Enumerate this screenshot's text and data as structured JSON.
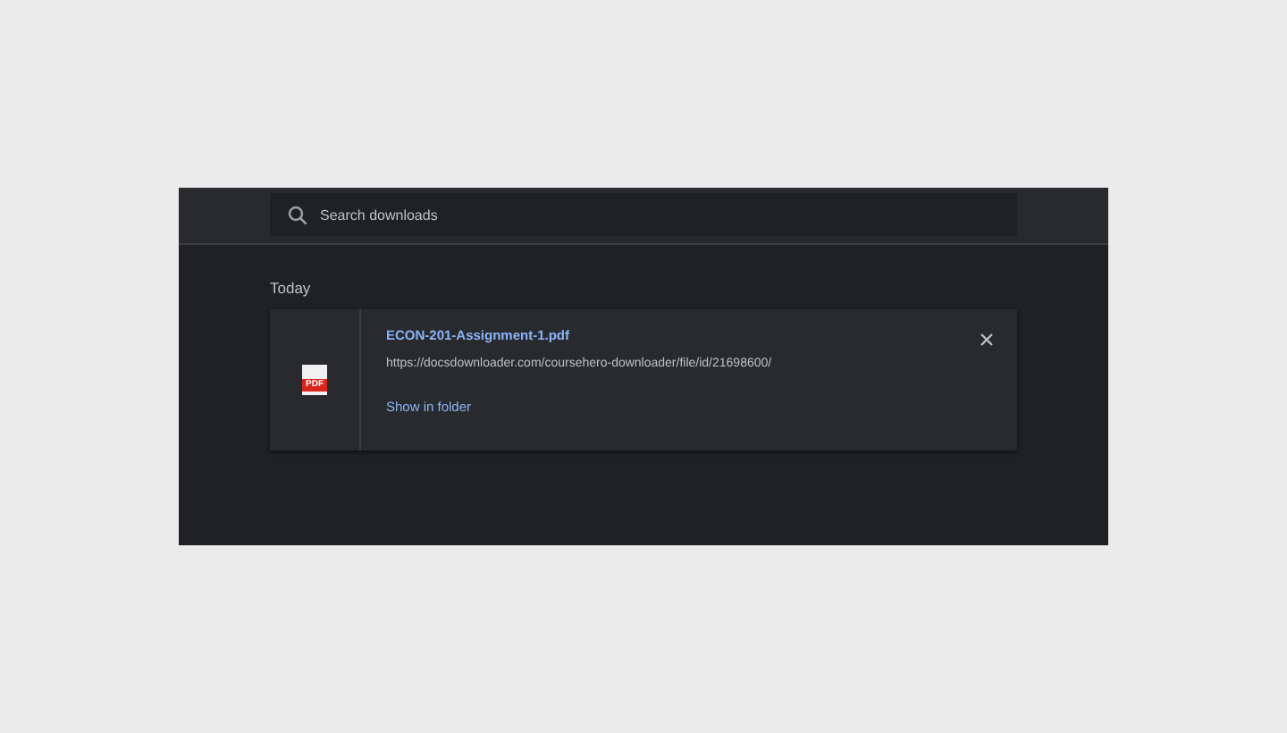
{
  "search": {
    "placeholder": "Search downloads"
  },
  "groups": [
    {
      "heading": "Today",
      "items": [
        {
          "file_name": "ECON-201-Assignment-1.pdf",
          "file_type_label": "PDF",
          "url": "https://docsdownloader.com/coursehero-downloader/file/id/21698600/",
          "action": "Show in folder"
        }
      ]
    }
  ]
}
